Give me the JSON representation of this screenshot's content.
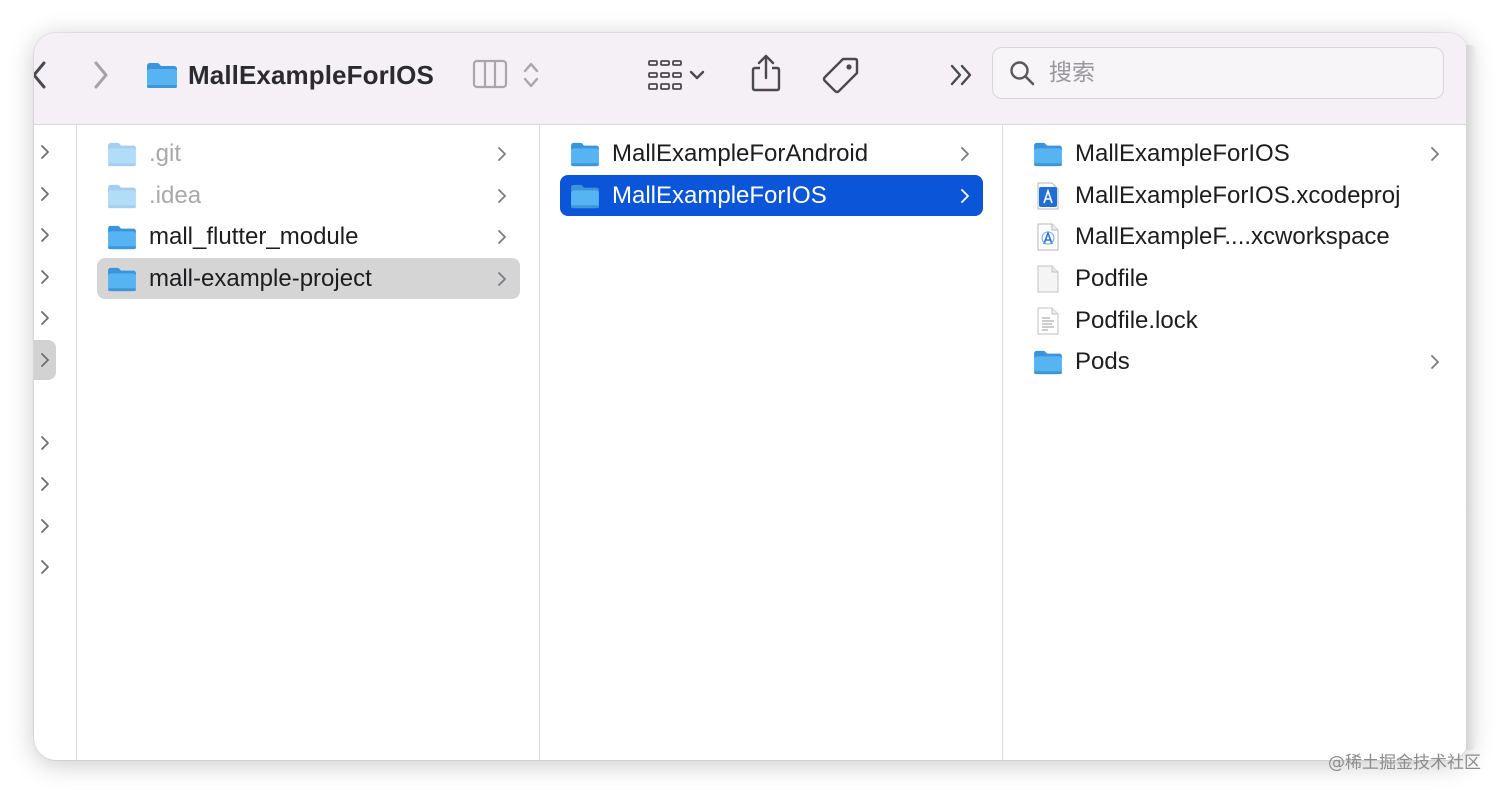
{
  "toolbar": {
    "title": "MallExampleForIOS",
    "search_placeholder": "搜索"
  },
  "sidebar_stub": {
    "selected_index": 5,
    "count": 11
  },
  "column1": {
    "items": [
      {
        "label": ".git",
        "icon": "folder-icon",
        "dim": true,
        "has_children": true
      },
      {
        "label": ".idea",
        "icon": "folder-icon",
        "dim": true,
        "has_children": true
      },
      {
        "label": "mall_flutter_module",
        "icon": "folder-icon",
        "dim": false,
        "has_children": true
      },
      {
        "label": "mall-example-project",
        "icon": "folder-icon",
        "dim": false,
        "has_children": true,
        "selected": "inactive"
      }
    ]
  },
  "column2": {
    "items": [
      {
        "label": "MallExampleForAndroid",
        "icon": "folder-icon",
        "has_children": true
      },
      {
        "label": "MallExampleForIOS",
        "icon": "folder-icon",
        "has_children": true,
        "selected": "active"
      }
    ]
  },
  "column3": {
    "items": [
      {
        "label": "MallExampleForIOS",
        "icon": "folder-icon",
        "has_children": true
      },
      {
        "label": "MallExampleForIOS.xcodeproj",
        "icon": "xcodeproj-icon",
        "has_children": false
      },
      {
        "label": "MallExampleF....xcworkspace",
        "icon": "xcworkspace-icon",
        "has_children": false
      },
      {
        "label": "Podfile",
        "icon": "blank-file-icon",
        "has_children": false
      },
      {
        "label": "Podfile.lock",
        "icon": "text-file-icon",
        "has_children": false
      },
      {
        "label": "Pods",
        "icon": "folder-icon",
        "has_children": true
      }
    ]
  },
  "colors": {
    "selection_active": "#0b55d9",
    "selection_inactive": "#d5d5d6",
    "folder_blue": "#4aa8ec",
    "toolbar_bg": "#f4f0f6"
  },
  "watermark": "@稀土掘金技术社区"
}
